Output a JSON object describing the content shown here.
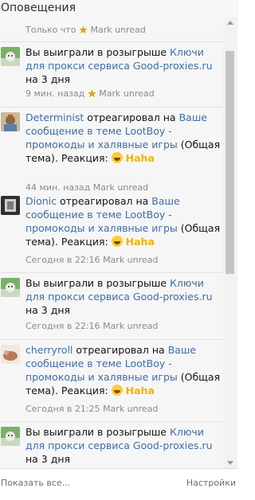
{
  "header": {
    "title": "Оповещения"
  },
  "notifications": [
    {
      "meta_time": "Только что",
      "mark": "Mark unread"
    },
    {
      "text_pre": "Вы выиграли в розыгрыше",
      "link": "Ключи для прокси сервиса Good-proxies.ru",
      "text_post": "на 3 дня",
      "meta_time": "9 мин. назад",
      "mark": "Mark unread"
    },
    {
      "user": "Determinist",
      "verb": "отреагировал на",
      "link": "Ваше сообщение в теме LootBoy - промокоды и халявные игры",
      "context": "(Общая тема). Реакция:",
      "reaction": "Haha",
      "meta_time": "44 мин. назад",
      "mark": "Mark unread"
    },
    {
      "user": "Dionic",
      "verb": "отреагировал на",
      "link": "Ваше сообщение в теме LootBoy - промокоды и халявные игры",
      "context": "(Общая тема). Реакция:",
      "reaction": "Haha",
      "meta_time": "Сегодня в 22:16",
      "mark": "Mark unread"
    },
    {
      "text_pre": "Вы выиграли в розыгрыше",
      "link": "Ключи для прокси сервиса Good-proxies.ru",
      "text_post": "на 3 дня",
      "meta_time": "Сегодня в 22:16",
      "mark": "Mark unread"
    },
    {
      "user": "cherryroll",
      "verb": "отреагировал на",
      "link": "Ваше сообщение в теме LootBoy - промокоды и халявные игры",
      "context": "(Общая тема). Реакция:",
      "reaction": "Haha",
      "meta_time": "Сегодня в 21:25",
      "mark": "Mark unread"
    },
    {
      "text_pre": "Вы выиграли в розыгрыше",
      "link": "Ключи для прокси сервиса Good-proxies.ru",
      "text_post": "на 3 дня"
    }
  ],
  "footer": {
    "show_all": "Показать все...",
    "settings": "Настройки"
  },
  "icons": {
    "star": "star-icon",
    "reaction": "haha-emoji-icon",
    "avatar": "avatar"
  },
  "colors": {
    "link": "#3f6ea8",
    "reaction": "#f0b400",
    "star": "#e3a21a"
  }
}
